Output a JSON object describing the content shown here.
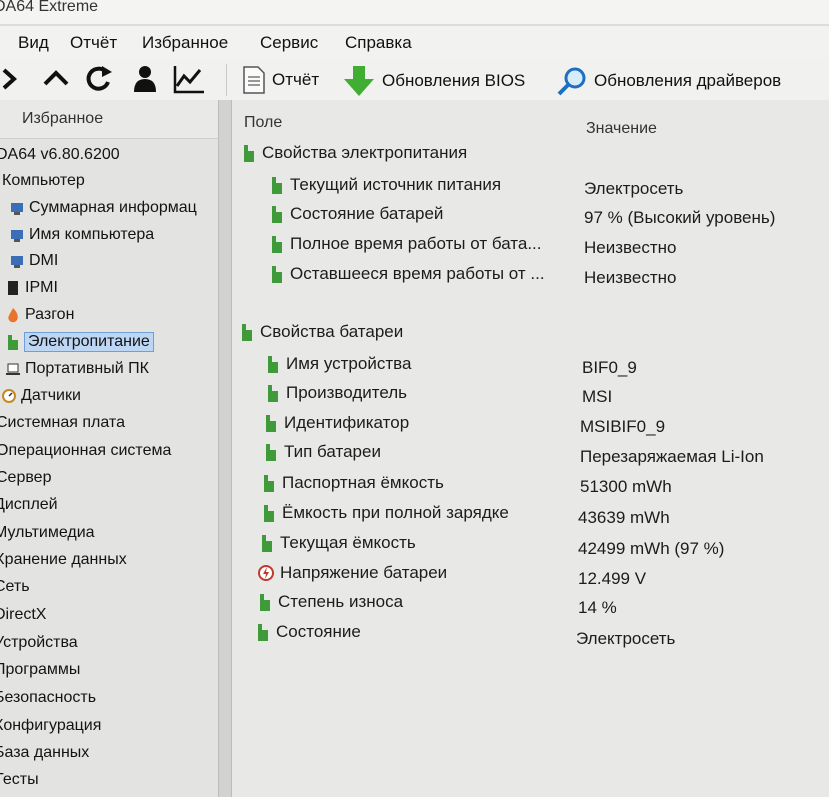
{
  "window": {
    "title": "DA64 Extreme"
  },
  "menu": [
    "Вид",
    "Отчёт",
    "Избранное",
    "Сервис",
    "Справка"
  ],
  "toolbar": {
    "nav_icons": [
      "chevron-right-icon",
      "chevron-up-icon",
      "refresh-icon",
      "user-icon",
      "chart-icon"
    ],
    "buttons": [
      {
        "label": "Отчёт",
        "icon": "report-icon"
      },
      {
        "label": "Обновления BIOS",
        "icon": "download-arrow-icon"
      },
      {
        "label": "Обновления драйверов",
        "icon": "search-icon"
      }
    ]
  },
  "sidebar": {
    "header": "Избранное",
    "items": [
      {
        "label": "DA64 v6.80.6200",
        "icon": ""
      },
      {
        "label": "Компьютер",
        "icon": ""
      },
      {
        "label": "Суммарная информац",
        "icon": "summary-icon"
      },
      {
        "label": "Имя компьютера",
        "icon": "computer-name-icon"
      },
      {
        "label": "DMI",
        "icon": "dmi-icon"
      },
      {
        "label": "IPMI",
        "icon": "ipmi-icon"
      },
      {
        "label": "Разгон",
        "icon": "flame-icon"
      },
      {
        "label": "Электропитание",
        "icon": "battery-icon",
        "selected": true
      },
      {
        "label": "Портативный ПК",
        "icon": "laptop-icon"
      },
      {
        "label": "Датчики",
        "icon": "sensor-icon"
      },
      {
        "label": "Системная плата",
        "icon": ""
      },
      {
        "label": "Операционная система",
        "icon": ""
      },
      {
        "label": "Сервер",
        "icon": ""
      },
      {
        "label": "Дисплей",
        "icon": ""
      },
      {
        "label": "Мультимедиа",
        "icon": ""
      },
      {
        "label": "Хранение данных",
        "icon": ""
      },
      {
        "label": "Сеть",
        "icon": ""
      },
      {
        "label": "DirectX",
        "icon": ""
      },
      {
        "label": "Устройства",
        "icon": ""
      },
      {
        "label": "Программы",
        "icon": ""
      },
      {
        "label": "Безопасность",
        "icon": ""
      },
      {
        "label": "Конфигурация",
        "icon": ""
      },
      {
        "label": "База данных",
        "icon": ""
      },
      {
        "label": "Тесты",
        "icon": ""
      }
    ]
  },
  "table": {
    "columns": [
      "Поле",
      "Значение"
    ],
    "sections": [
      {
        "title": "Свойства электропитания",
        "rows": [
          {
            "field": "Текущий источник питания",
            "value": "Электросеть"
          },
          {
            "field": "Состояние батарей",
            "value": "97 % (Высокий уровень)"
          },
          {
            "field": "Полное время работы от бата...",
            "value": "Неизвестно"
          },
          {
            "field": "Оставшееся время работы от ...",
            "value": "Неизвестно"
          }
        ]
      },
      {
        "title": "Свойства батареи",
        "rows": [
          {
            "field": "Имя устройства",
            "value": "BIF0_9"
          },
          {
            "field": "Производитель",
            "value": "MSI"
          },
          {
            "field": "Идентификатор",
            "value": "MSIBIF0_9"
          },
          {
            "field": "Тип батареи",
            "value": "Перезаряжаемая Li-Ion"
          },
          {
            "field": "Паспортная ёмкость",
            "value": "51300 mWh"
          },
          {
            "field": "Ёмкость при полной зарядке",
            "value": "43639 mWh"
          },
          {
            "field": "Текущая ёмкость",
            "value": "42499 mWh  (97 %)"
          },
          {
            "field": "Напряжение батареи",
            "value": "12.499 V",
            "icon": "voltage-icon"
          },
          {
            "field": "Степень износа",
            "value": "14 %"
          },
          {
            "field": "Состояние",
            "value": "Электросеть"
          }
        ]
      }
    ]
  },
  "colors": {
    "battery_green": "#3f9b3a",
    "selection": "#bcd6f3",
    "voltage_red": "#c0392b"
  }
}
